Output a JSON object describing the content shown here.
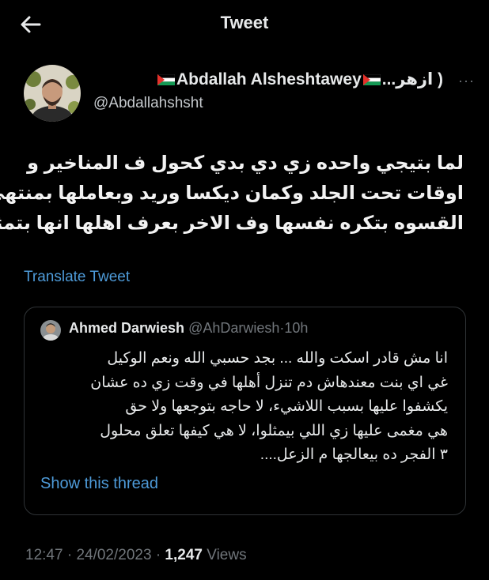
{
  "header": {
    "title": "Tweet"
  },
  "author": {
    "display_name": "Abdallah Alsheshtawey",
    "name_tail": "( ازهر...",
    "handle": "@Abdallahshsht",
    "more": "···"
  },
  "tweet": {
    "lines": [
      "لما بتيجي واحده زي دي بدي كحول ف المناخير و",
      "اوقات تحت الجلد وكمان ديكسا وريد وبعاملها بمنتهي",
      "القسوه بتكره نفسها وف الاخر بعرف اهلها انها بتمثل"
    ]
  },
  "translate_label": "Translate Tweet",
  "quote": {
    "name": "Ahmed Darwiesh",
    "handle": "@AhDarwiesh",
    "separator": "·",
    "time": "10h",
    "lines": [
      "انا مش قادر اسكت والله ... بجد حسبي الله ونعم الوكيل",
      "غي اي بنت معندهاش دم تنزل أهلها في وقت زي ده عشان",
      "يكشفوا عليها بسبب اللاشيء، لا حاجه بتوجعها ولا حق",
      "هي مغمى عليها زي اللي بيمثلوا، لا هي كيفها تعلق محلول",
      "٣ الفجر ده بيعالجها م الزعل...."
    ],
    "show_thread": "Show this thread"
  },
  "meta": {
    "time": "12:47",
    "date": "24/02/2023",
    "separator": "·",
    "views_count": "1,247",
    "views_label": "Views"
  },
  "colors": {
    "background": "#000000",
    "text": "#e7e9ea",
    "secondary": "#71767b",
    "link": "#4e9bd9",
    "border": "#2f3336"
  },
  "icons": {
    "back": "arrow-left-icon",
    "flag": "palestine-flag-icon"
  }
}
